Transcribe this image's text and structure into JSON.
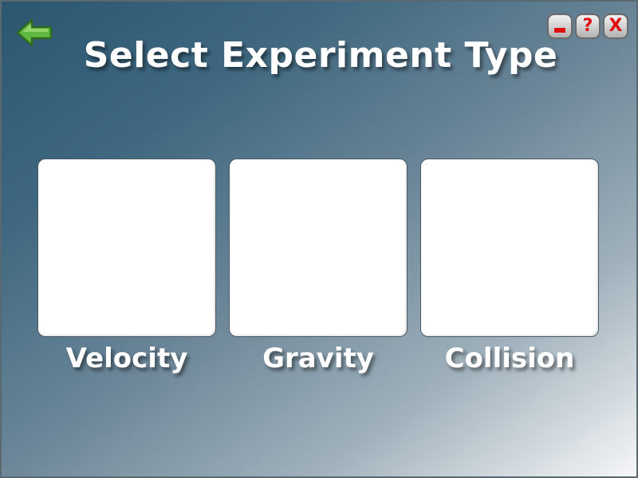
{
  "header": {
    "title": "Select Experiment Type",
    "back_icon": "arrow-left-icon",
    "back_color": "#6cc24a"
  },
  "window_controls": {
    "minimize_icon": "minimize-icon",
    "help_label": "?",
    "close_label": "X",
    "icon_color": "#e01010"
  },
  "experiments": [
    {
      "label": "Velocity"
    },
    {
      "label": "Gravity"
    },
    {
      "label": "Collision"
    }
  ]
}
